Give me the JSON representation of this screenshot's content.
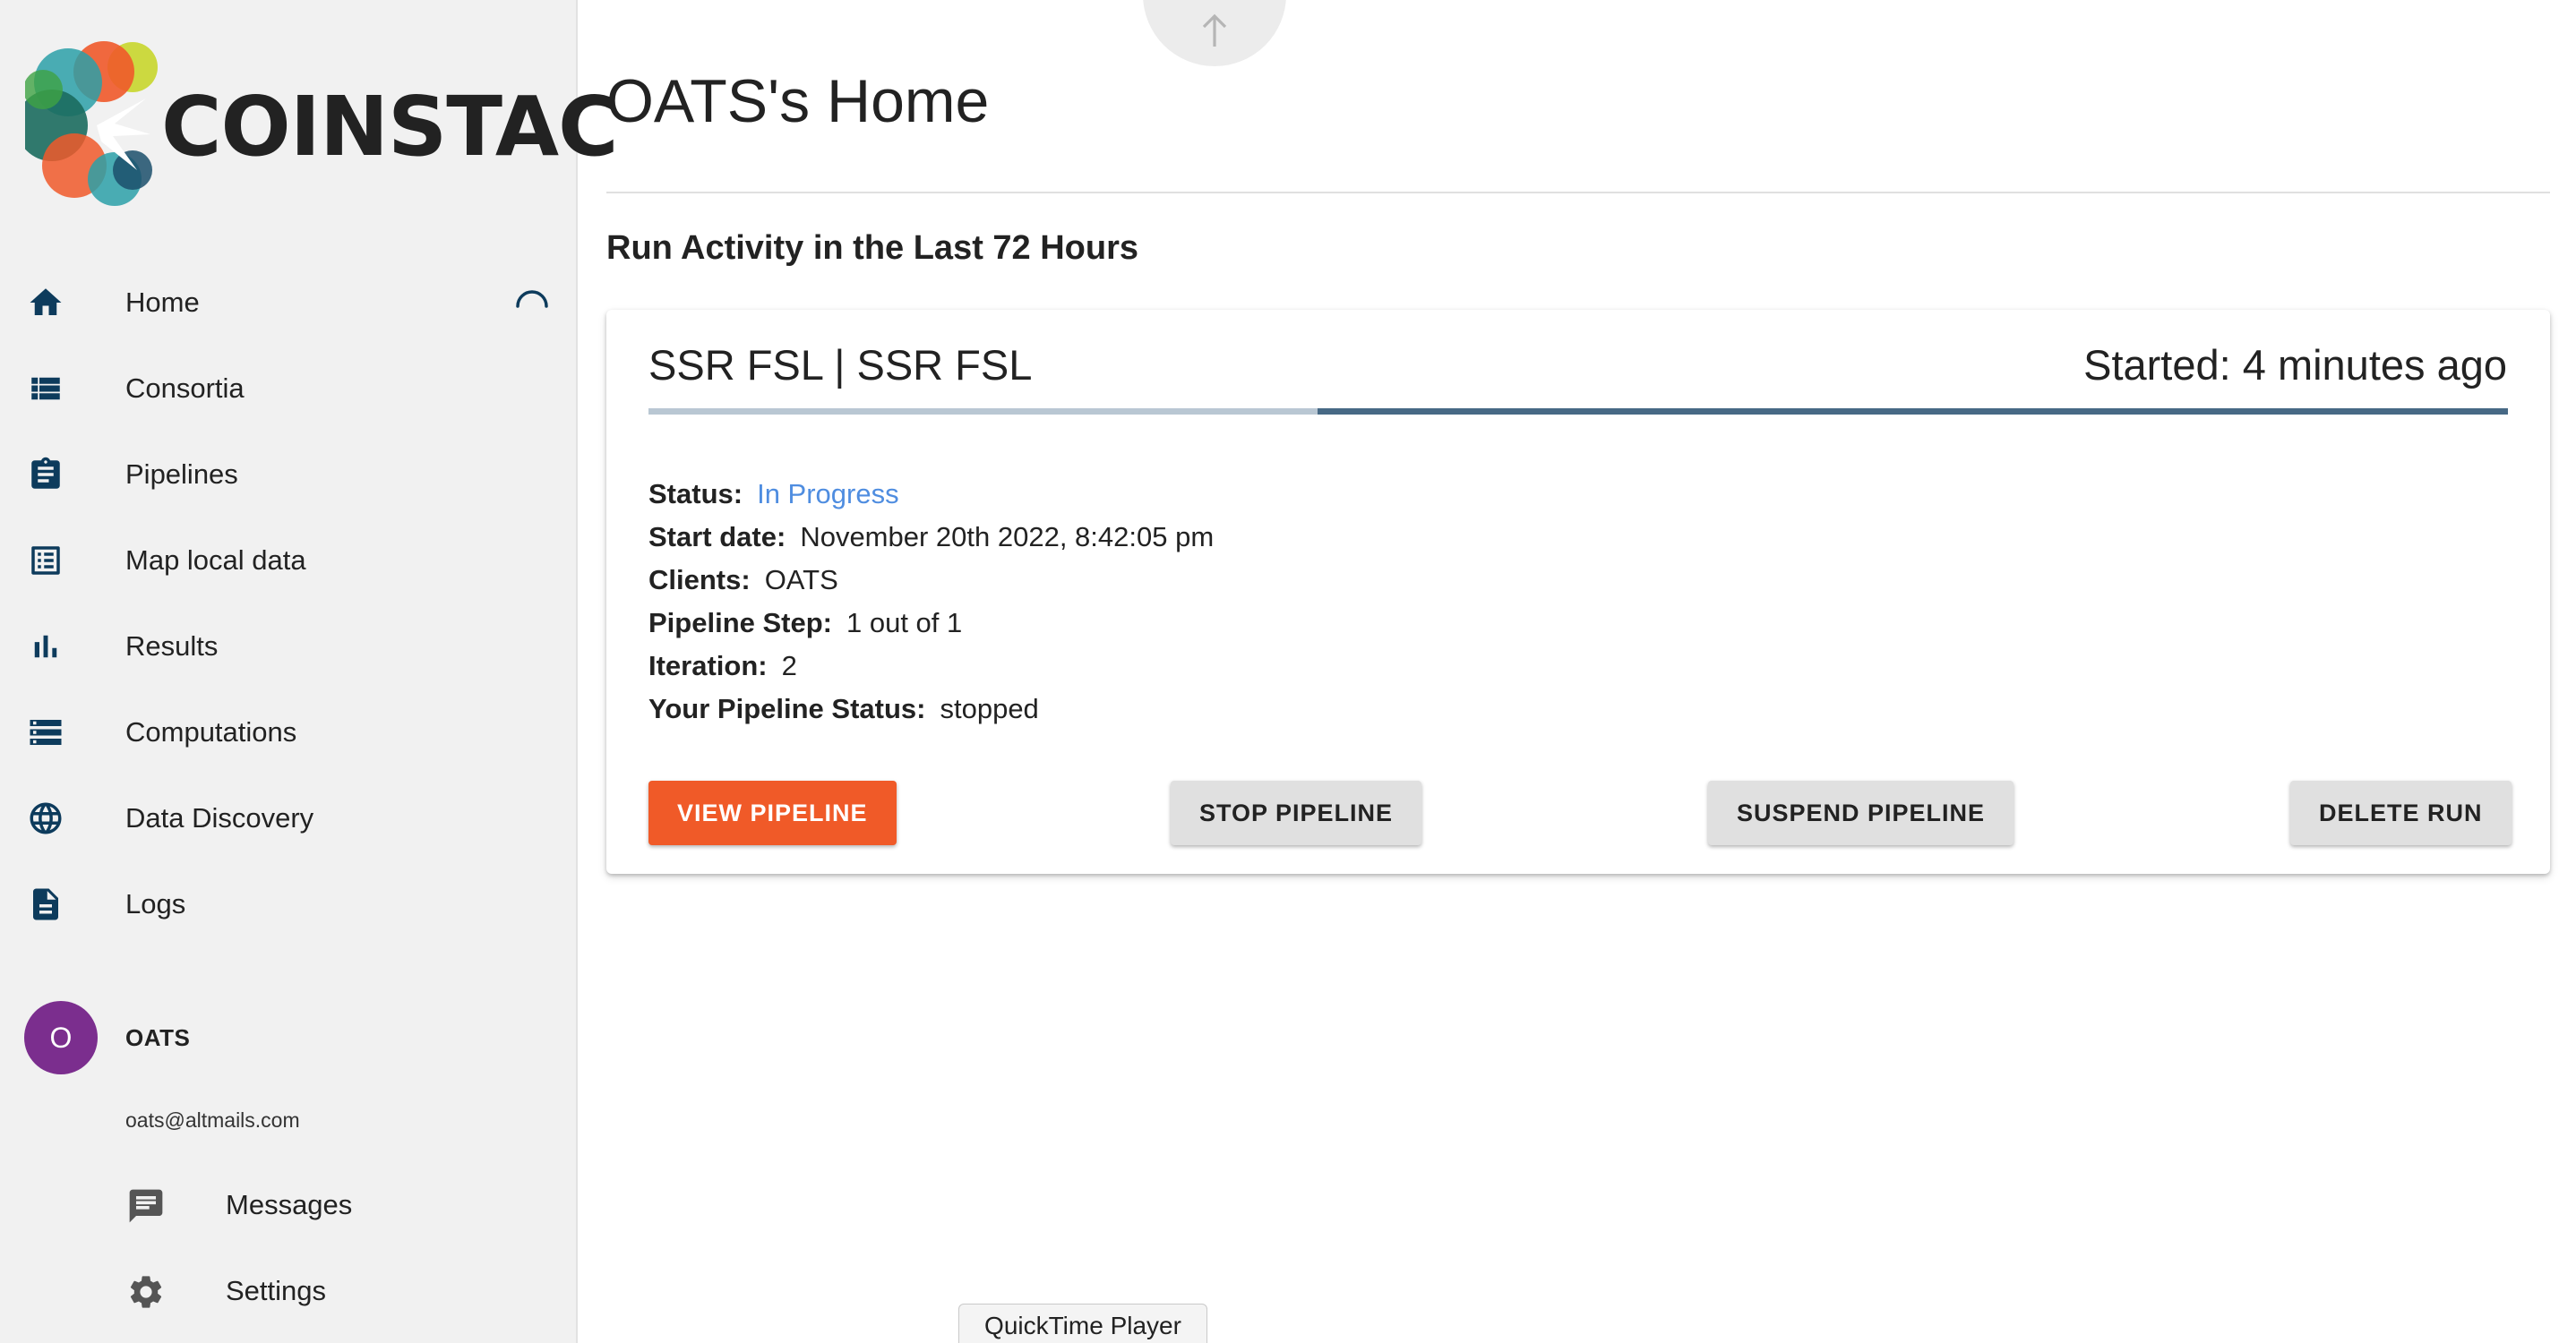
{
  "app": {
    "logo_text": "COINSTAC"
  },
  "sidebar": {
    "items": [
      {
        "label": "Home",
        "icon": "home-icon"
      },
      {
        "label": "Consortia",
        "icon": "list-icon"
      },
      {
        "label": "Pipelines",
        "icon": "clipboard-icon"
      },
      {
        "label": "Map local data",
        "icon": "table-list-icon"
      },
      {
        "label": "Results",
        "icon": "bar-chart-icon"
      },
      {
        "label": "Computations",
        "icon": "storage-icon"
      },
      {
        "label": "Data Discovery",
        "icon": "globe-icon"
      },
      {
        "label": "Logs",
        "icon": "document-icon"
      }
    ],
    "user": {
      "initial": "O",
      "name": "OATS",
      "email": "oats@altmails.com",
      "avatar_color": "#7b2e8e"
    },
    "sub_items": [
      {
        "label": "Messages",
        "icon": "message-icon"
      },
      {
        "label": "Settings",
        "icon": "gear-icon"
      }
    ]
  },
  "main": {
    "title": "OATS's Home",
    "section_title": "Run Activity in the Last 72 Hours",
    "run": {
      "title": "SSR FSL | SSR FSL",
      "started": "Started: 4 minutes ago",
      "progress_percent": 36,
      "details": [
        {
          "key": "Status:",
          "value": "In Progress"
        },
        {
          "key": "Start date:",
          "value": "November 20th 2022, 8:42:05 pm"
        },
        {
          "key": "Clients:",
          "value": "OATS"
        },
        {
          "key": "Pipeline Step:",
          "value": "1 out of 1"
        },
        {
          "key": "Iteration:",
          "value": "2"
        },
        {
          "key": "Your Pipeline Status:",
          "value": "stopped"
        }
      ],
      "buttons": {
        "view": "VIEW PIPELINE",
        "stop": "STOP PIPELINE",
        "suspend": "SUSPEND PIPELINE",
        "delete": "DELETE RUN"
      }
    }
  },
  "tooltip": "QuickTime Player",
  "colors": {
    "accent": "#f05a28",
    "status_in_progress": "#4f8de0",
    "progress_fill": "#476985",
    "progress_track": "#b9c7d3",
    "nav_icon": "#0d3b5c"
  }
}
